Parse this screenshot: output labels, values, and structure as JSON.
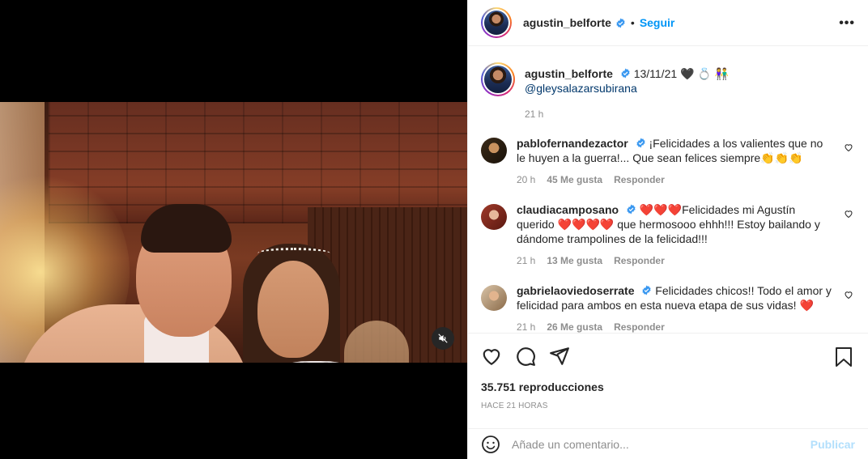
{
  "post": {
    "author": "agustin_belforte",
    "follow_label": "Seguir",
    "separator": "•",
    "more_label": "•••",
    "caption_date": "13/11/21",
    "caption_emoji": "🖤 💍 👫",
    "caption_mention": "@gleysalazarsubirana",
    "caption_time": "21 h",
    "views": "35.751 reproducciones",
    "posted_ago": "HACE 21 HORAS"
  },
  "comments": [
    {
      "user": "pablofernandezactor",
      "text": "¡Felicidades a los valientes que no le huyen a la guerra!... Que sean felices siempre👏👏👏",
      "time": "20 h",
      "likes": "45 Me gusta",
      "reply": "Responder"
    },
    {
      "user": "claudiacamposano",
      "hearts_pre": "❤️❤️❤️",
      "text": "Felicidades mi Agustín querido",
      "hearts_mid": "❤️❤️❤️❤️",
      "text2": " que hermosooo ehhh!!! Estoy bailando y dándome trampolines de la felicidad!!!",
      "time": "21 h",
      "likes": "13 Me gusta",
      "reply": "Responder"
    },
    {
      "user": "gabrielaoviedoserrate",
      "text": "Felicidades chicos!! Todo el amor y felicidad para ambos en esta nueva etapa de sus vidas!",
      "heart": "❤️",
      "time": "21 h",
      "likes": "26 Me gusta",
      "reply": "Responder"
    }
  ],
  "add_comment": {
    "placeholder": "Añade un comentario...",
    "publish_label": "Publicar"
  },
  "colors": {
    "accent": "#0095f6",
    "publish_disabled": "#b2dffc",
    "muted": "#8e8e8e",
    "text": "#262626"
  }
}
